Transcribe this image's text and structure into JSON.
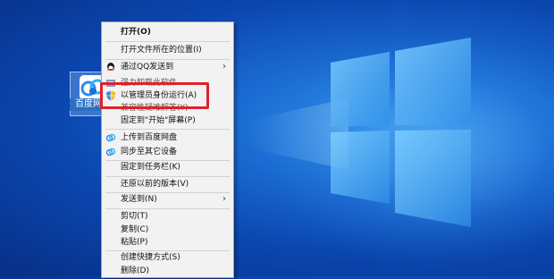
{
  "desktop_icon": {
    "label": "百度网盘"
  },
  "menu": {
    "items": [
      {
        "label": "打开(O)"
      },
      {
        "label": "打开文件所在的位置(I)"
      },
      {
        "label": "通过QQ发送到"
      },
      {
        "label": "强力卸载此软件"
      },
      {
        "label": "以管理员身份运行(A)"
      },
      {
        "label": "兼容性疑难解答(Y)"
      },
      {
        "label": "固定到\"开始\"屏幕(P)"
      },
      {
        "label": "上传到百度网盘"
      },
      {
        "label": "同步至其它设备"
      },
      {
        "label": "固定到任务栏(K)"
      },
      {
        "label": "还原以前的版本(V)"
      },
      {
        "label": "发送到(N)"
      },
      {
        "label": "剪切(T)"
      },
      {
        "label": "复制(C)"
      },
      {
        "label": "粘贴(P)"
      },
      {
        "label": "创建快捷方式(S)"
      },
      {
        "label": "删除(D)"
      }
    ]
  },
  "colors": {
    "highlight_box": "#e0202a",
    "menu_background": "#f2f2f2",
    "desktop_blue": "#0b47b0"
  },
  "icons": [
    "baidu-netdisk-icon",
    "qq-icon",
    "uninstall-icon",
    "uac-shield-icon",
    "cloud-upload-icon",
    "sync-icon",
    "chevron-right-icon",
    "windows-logo-icon"
  ]
}
